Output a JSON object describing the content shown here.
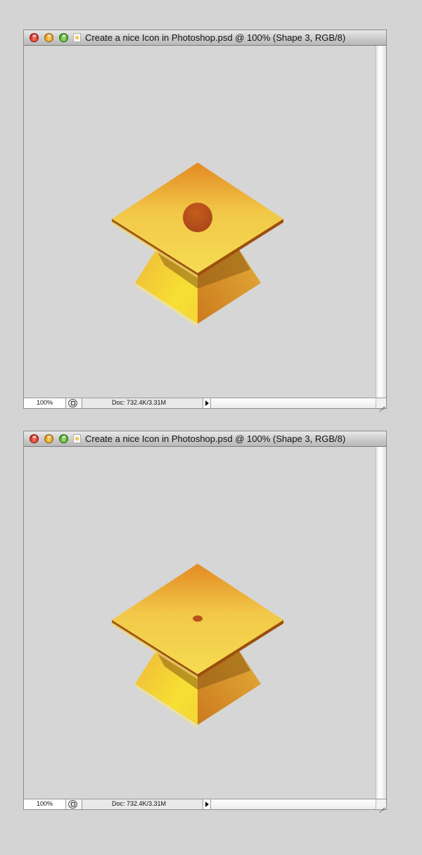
{
  "colors": {
    "cap_top_dark": "#e38a22",
    "cap_top_light": "#f5d94e",
    "cap_rim": "#9c4f0c",
    "cap_base_left": "#f7e033",
    "cap_base_right": "#d07a1d",
    "button": "#b8521a"
  },
  "windows": [
    {
      "title": "Create a nice Icon in Photoshop.psd @ 100% (Shape 3, RGB/8)",
      "zoom": "100%",
      "doc_info": "Doc: 732.4K/3.31M",
      "icons": {
        "close": "close-icon",
        "minimize": "minimize-icon",
        "zoom": "zoom-icon",
        "doc": "document-icon",
        "status": "status-options-icon",
        "arrow": "triangle-right-icon",
        "grip": "resize-grip-icon"
      },
      "artwork": "graduation-cap-large-button"
    },
    {
      "title": "Create a nice Icon in Photoshop.psd @ 100% (Shape 3, RGB/8)",
      "zoom": "100%",
      "doc_info": "Doc: 732.4K/3.31M",
      "icons": {
        "close": "close-icon",
        "minimize": "minimize-icon",
        "zoom": "zoom-icon",
        "doc": "document-icon",
        "status": "status-options-icon",
        "arrow": "triangle-right-icon",
        "grip": "resize-grip-icon"
      },
      "artwork": "graduation-cap-small-button"
    }
  ]
}
